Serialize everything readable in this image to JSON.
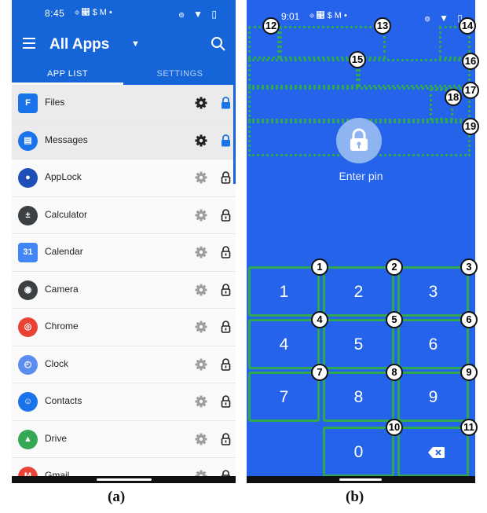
{
  "panel_a": {
    "status_bar": {
      "time": "8:45",
      "icons": "⊘ ෉ $ M •",
      "right_icons": "๏ ▼ ▯"
    },
    "app_bar": {
      "title": "All Apps"
    },
    "tabs": [
      {
        "label": "APP LIST"
      },
      {
        "label": "SETTINGS"
      }
    ],
    "apps": [
      {
        "name": "Files",
        "icon": "files-icon",
        "color": "#1a73e8",
        "glyph": "F",
        "locked": true
      },
      {
        "name": "Messages",
        "icon": "messages-icon",
        "color": "#1a73e8",
        "glyph": "▤",
        "locked": true
      },
      {
        "name": "AppLock",
        "icon": "applock-icon",
        "color": "#1e4fb8",
        "glyph": "●",
        "locked": false
      },
      {
        "name": "Calculator",
        "icon": "calculator-icon",
        "color": "#3c4043",
        "glyph": "±",
        "locked": false
      },
      {
        "name": "Calendar",
        "icon": "calendar-icon",
        "color": "#4285f4",
        "glyph": "31",
        "locked": false
      },
      {
        "name": "Camera",
        "icon": "camera-icon",
        "color": "#3c4043",
        "glyph": "◉",
        "locked": false
      },
      {
        "name": "Chrome",
        "icon": "chrome-icon",
        "color": "#ea4335",
        "glyph": "◎",
        "locked": false
      },
      {
        "name": "Clock",
        "icon": "clock-icon",
        "color": "#5b8def",
        "glyph": "◴",
        "locked": false
      },
      {
        "name": "Contacts",
        "icon": "contacts-icon",
        "color": "#1a73e8",
        "glyph": "☺",
        "locked": false
      },
      {
        "name": "Drive",
        "icon": "drive-icon",
        "color": "#34a853",
        "glyph": "▲",
        "locked": false
      },
      {
        "name": "Gmail",
        "icon": "gmail-icon",
        "color": "#ea4335",
        "glyph": "M",
        "locked": false
      }
    ],
    "colors": {
      "primary": "#1565d8",
      "locked_active": "#1a73e8"
    }
  },
  "panel_b": {
    "status_bar": {
      "time": "9:01",
      "icons": "⊘ ෉ $ M •",
      "right_icons": "๏ ▼ ▯"
    },
    "prompt": "Enter pin",
    "keys": [
      {
        "label": "1",
        "badge": "1"
      },
      {
        "label": "2",
        "badge": "2"
      },
      {
        "label": "3",
        "badge": "3"
      },
      {
        "label": "4",
        "badge": "4"
      },
      {
        "label": "5",
        "badge": "5"
      },
      {
        "label": "6",
        "badge": "6"
      },
      {
        "label": "7",
        "badge": "7"
      },
      {
        "label": "8",
        "badge": "8"
      },
      {
        "label": "9",
        "badge": "9"
      },
      {
        "label": "0",
        "badge": "10"
      },
      {
        "label": "",
        "badge": "11"
      }
    ],
    "region_badges": [
      "12",
      "13",
      "14",
      "15",
      "16",
      "17",
      "18",
      "19"
    ],
    "colors": {
      "background": "#2563eb",
      "annotation": "#2fa84f"
    }
  },
  "captions": {
    "a": "(a)",
    "b": "(b)"
  }
}
